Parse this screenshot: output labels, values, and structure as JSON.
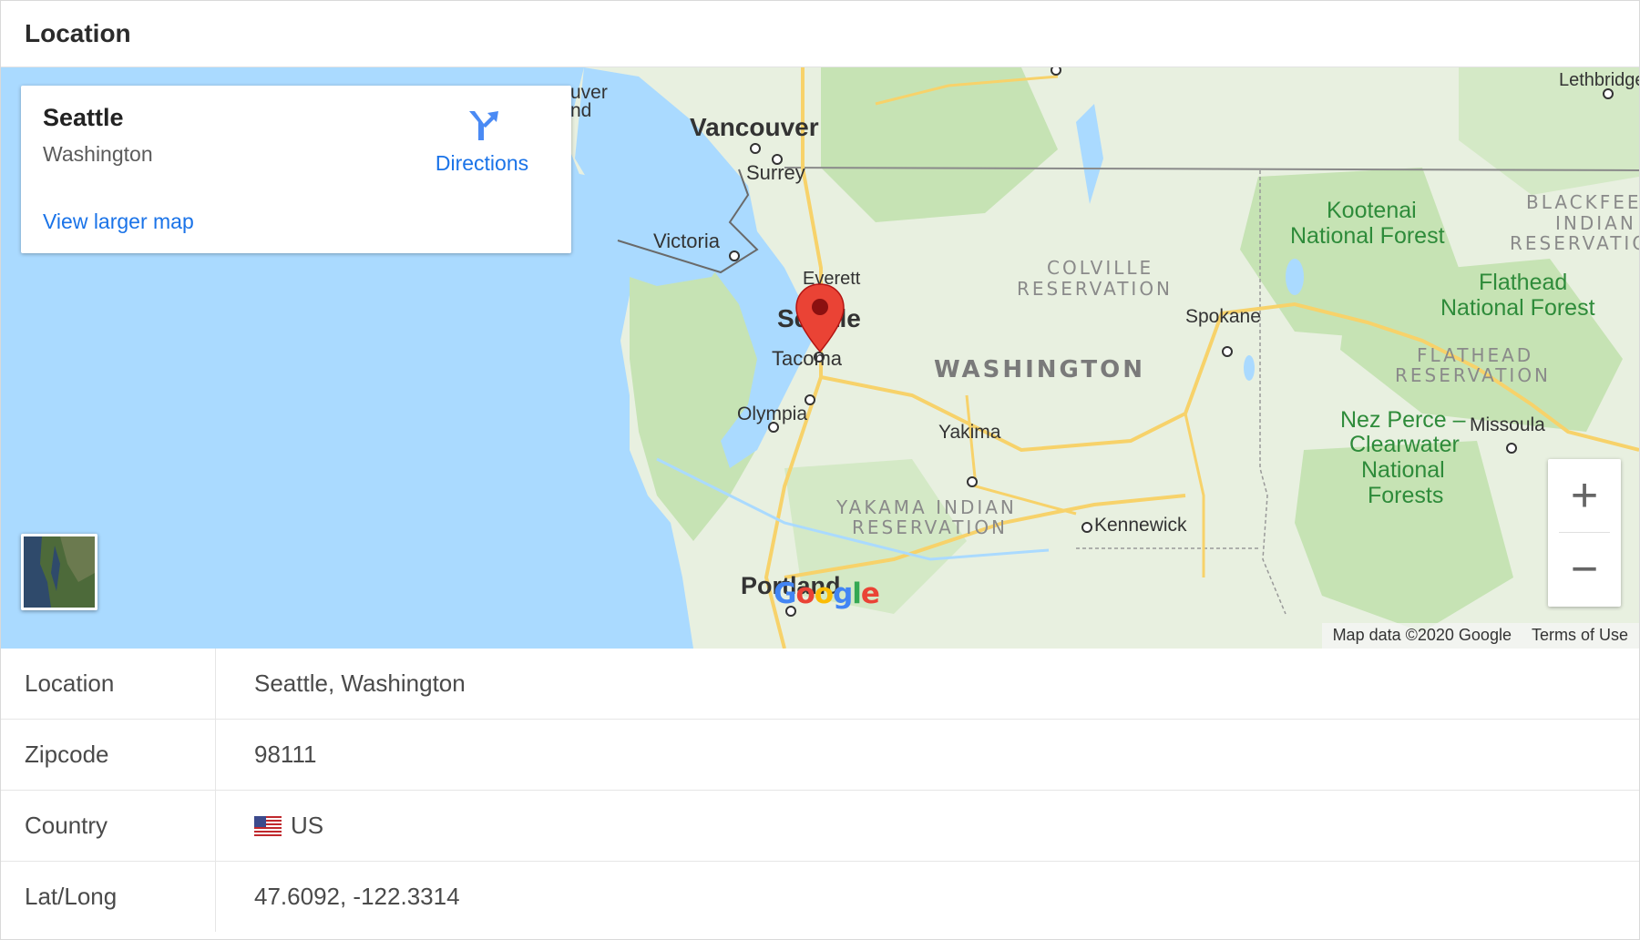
{
  "header": {
    "title": "Location"
  },
  "map": {
    "card": {
      "title": "Seattle",
      "subtitle": "Washington",
      "view_larger": "View larger map",
      "directions": "Directions"
    },
    "labels": {
      "vancouver": "Vancouver",
      "surrey": "Surrey",
      "victoria": "Victoria",
      "everett": "Everett",
      "seattle": "Seattle",
      "tacoma": "Tacoma",
      "olympia": "Olympia",
      "portland": "Portland",
      "yakima": "Yakima",
      "kennewick": "Kennewick",
      "spokane": "Spokane",
      "missoula": "Missoula",
      "lethbridge": "Lethbridge",
      "washington": "WASHINGTON",
      "colville_1": "COLVILLE",
      "colville_2": "RESERVATION",
      "yakama_1": "YAKAMA INDIAN",
      "yakama_2": "RESERVATION",
      "flathead_res_1": "FLATHEAD",
      "flathead_res_2": "RESERVATION",
      "blackfeet_1": "BLACKFEET",
      "blackfeet_2": "INDIAN",
      "blackfeet_3": "RESERVATION",
      "kootenai_1": "Kootenai",
      "kootenai_2": "National Forest",
      "flathead_nf_1": "Flathead",
      "flathead_nf_2": "National Forest",
      "nezperce_1": "Nez Perce –",
      "nezperce_2": "Clearwater",
      "nezperce_3": "National",
      "nezperce_4": "Forests",
      "uver": "uver",
      "nd": "nd"
    },
    "zoom_in": "+",
    "zoom_out": "−",
    "attribution": "Map data ©2020 Google",
    "terms": "Terms of Use",
    "logo": [
      "G",
      "o",
      "o",
      "g",
      "l",
      "e"
    ],
    "logo_colors": [
      "#4285f4",
      "#ea4335",
      "#fbbc05",
      "#4285f4",
      "#34a853",
      "#ea4335"
    ],
    "pin_color": "#ea4335",
    "icons": [
      "directions-icon",
      "map-pin-icon",
      "satellite-thumbnail"
    ]
  },
  "details": {
    "rows": [
      {
        "key": "Location",
        "value": "Seattle, Washington"
      },
      {
        "key": "Zipcode",
        "value": "98111"
      },
      {
        "key": "Country",
        "value": "US",
        "icon": "us-flag-icon"
      },
      {
        "key": "Lat/Long",
        "value": "47.6092, -122.3314"
      }
    ]
  }
}
